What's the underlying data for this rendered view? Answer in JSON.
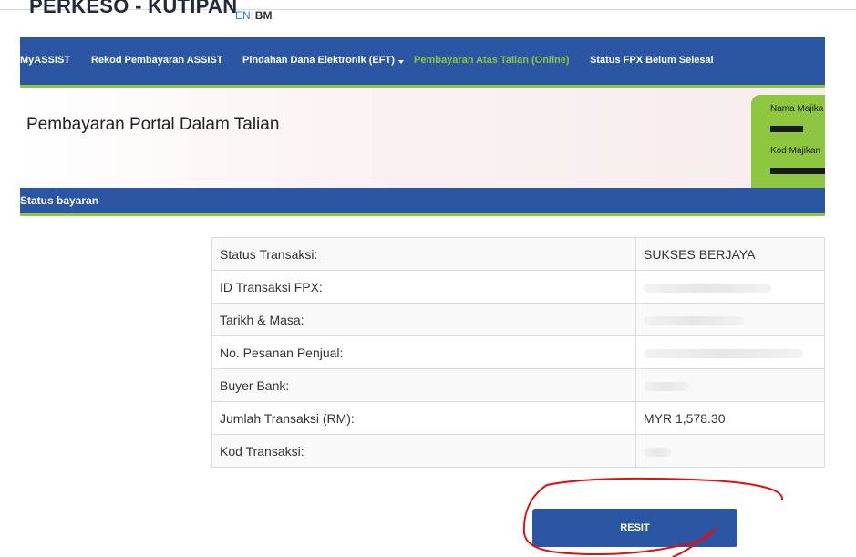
{
  "header": {
    "brand": "PERKESO - KUTIPAN",
    "lang_en": "EN",
    "lang_bm": "BM"
  },
  "nav": {
    "items": [
      {
        "label": "MyASSIST"
      },
      {
        "label": "Rekod Pembayaran ASSIST"
      },
      {
        "label": "Pindahan Dana Elektronik (EFT)"
      },
      {
        "label": "Pembayaran Atas Talian (Online)"
      },
      {
        "label": "Status FPX Belum Selesai"
      }
    ]
  },
  "page": {
    "title": "Pembayaran Portal Dalam Talian"
  },
  "employer": {
    "name_label": "Nama Majika",
    "code_label": "Kod Majikan"
  },
  "section": {
    "title": "Status bayaran"
  },
  "transaction": {
    "rows": [
      {
        "label": "Status Transaksi:",
        "value": "SUKSES BERJAYA"
      },
      {
        "label": "ID Transaksi FPX:",
        "value": ""
      },
      {
        "label": "Tarikh & Masa:",
        "value": ""
      },
      {
        "label": "No. Pesanan Penjual:",
        "value": ""
      },
      {
        "label": "Buyer Bank:",
        "value": ""
      },
      {
        "label": "Jumlah Transaksi (RM):",
        "value": "MYR 1,578.30"
      },
      {
        "label": "Kod Transaksi:",
        "value": ""
      }
    ]
  },
  "actions": {
    "resit_label": "RESIT"
  },
  "colors": {
    "navbar": "#2b56a3",
    "accent_green": "#8dc63f",
    "annotation_red": "#e01010"
  }
}
